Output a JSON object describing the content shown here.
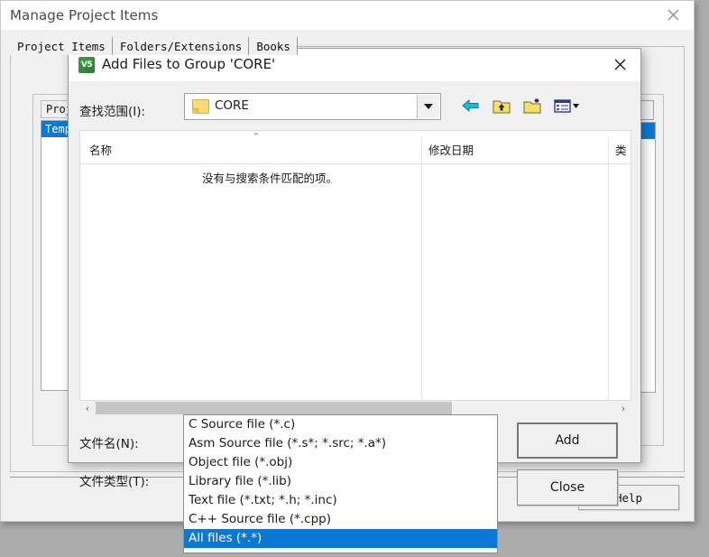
{
  "parent_window": {
    "title": "Manage Project Items",
    "close_icon": "close-icon",
    "tabs": [
      {
        "label": "Project Items",
        "active": true
      },
      {
        "label": "Folders/Extensions",
        "active": false
      },
      {
        "label": "Books",
        "active": false
      }
    ],
    "project_items_label": "Project",
    "project_items_selected": "Temp",
    "move_button_icon": "⬇",
    "help_button": "Help"
  },
  "dialog": {
    "icon_name": "keil-uvision-icon",
    "icon_text": "V5",
    "title": "Add Files to Group 'CORE'",
    "close_icon": "close-icon",
    "look_in": {
      "label": "查找范围(I):",
      "value": "CORE",
      "folder_icon": "folder-icon",
      "dropdown_icon": "chevron-down-icon"
    },
    "toolbar": [
      {
        "name": "back-icon",
        "glyph": "⬅"
      },
      {
        "name": "up-folder-icon",
        "glyph": "↑"
      },
      {
        "name": "new-folder-icon",
        "glyph": "+"
      },
      {
        "name": "view-mode-icon",
        "glyph": "▦"
      }
    ],
    "file_list": {
      "columns": [
        "名称",
        "修改日期",
        "类"
      ],
      "sort_indicator": "⌃",
      "empty_message": "没有与搜索条件匹配的项。",
      "rows": [],
      "scroll_left_icon": "‹",
      "scroll_right_icon": "›"
    },
    "file_name": {
      "label": "文件名(N):",
      "value": "",
      "placeholder": ""
    },
    "file_type": {
      "label": "文件类型(T):",
      "value": "C Source file (*.c)",
      "dropdown_icon": "chevron-down-icon",
      "options": [
        "C Source file (*.c)",
        "Asm Source file (*.s*; *.src; *.a*)",
        "Object file (*.obj)",
        "Library file (*.lib)",
        "Text file (*.txt; *.h; *.inc)",
        "C++ Source file (*.cpp)",
        "All files (*.*)"
      ],
      "selected_option": "All files (*.*)",
      "selected_index": 6
    },
    "buttons": {
      "add": "Add",
      "close": "Close"
    }
  },
  "colors": {
    "selection_blue": "#0a78d4",
    "window_bg": "#f0f0f0",
    "desktop_gray": "#ababab",
    "folder_yellow": "#fbd978"
  }
}
